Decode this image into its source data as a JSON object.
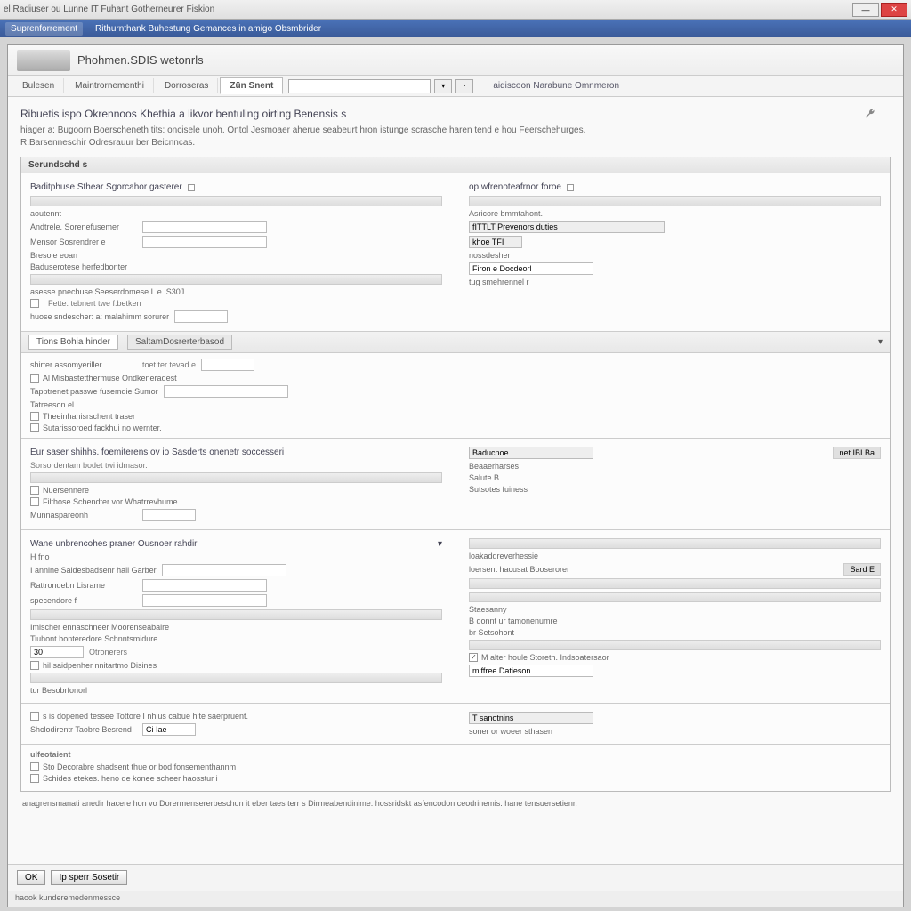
{
  "window": {
    "title": "el Radiuser ou Lunne IT Fuhant Gotherneurer Fiskion"
  },
  "titlebar_buttons": {
    "min": "—",
    "close": "✕"
  },
  "menubar": {
    "item0": "Suprenforrement",
    "item1": "Rithurnthank Buhestung Gemances in amigo Obsmbrider"
  },
  "header": {
    "title": "Phohmen.SDIS wetonrls"
  },
  "toolbar": {
    "tab0": "Bulesen",
    "tab1": "Maintrornementhi",
    "tab2": "Dorroseras",
    "tab3_active": "Zün Snent",
    "search_placeholder": "",
    "drop": "▾",
    "link": "aidiscoon Narabune Omnmeron"
  },
  "intro": {
    "heading": "Ribuetis ispo Okrennoos Khethia a likvor bentuling oirting Benensis s",
    "line1": "hiager a: Bugoorn Boerscheneth tits: oncisele unoh. Ontol Jesmoaer aherue seabeurt hron istunge scrasche haren tend e hou Feerschehurges.",
    "line2": "R.Barsenneschir Odresrauur ber Beicnncas."
  },
  "panel1": {
    "head": "Serundschd s",
    "left": {
      "subhead": "Baditphuse Sthear Sgorcahor gasterer",
      "f1": "aoutennt",
      "f2": "Andtrele. Sorenefusemer",
      "f3": "Mensor Sosrendrer e",
      "f4": "Bresoie eoan",
      "f5": "Baduserotese herfedbonter",
      "f6_label": "asesse pnechuse Seeserdomese L e IS30J",
      "f7": "Fette. tebnert twe f.betken",
      "f8": "huose sndescher: a: malahimm sorurer"
    },
    "right": {
      "subhead": "op wfrenoteafrnor foroe",
      "r1": "Asricore bmmtahont.",
      "r2_gray": "fITTLT Prevenors duties",
      "r3_gray": "khoe TFI",
      "r4": "nossdesher",
      "r5": "Firon e Docdeorl",
      "r6": "tug smehrennel r"
    }
  },
  "sect1": {
    "tab1": "Tions Bohia hinder",
    "tab2": "SaltamDosrerterbasod",
    "prompt": "shirter assomyeriller",
    "prompt2": "toet ter tevad e",
    "placeholder": ""
  },
  "block2": {
    "l1": "Al Misbastetthermuse Ondkeneradest",
    "l2": "Tapptrenet passwe fusemdie Sumor",
    "l3": "Tatreeson el",
    "l4": "Theeinhanisrschent traser",
    "l5": "Sutarissoroed fackhui no wernter."
  },
  "panel2": {
    "head_l": "Eur saser shihhs. foemiterens ov io Sasderts onenetr soccesseri",
    "head_r": "Baducnoe",
    "sub": "Sorsordentam bodet twi idmasor.",
    "right_badge": "net IBI Ba",
    "l1": "Nuersennere",
    "l2": "Filthose Schendter vor Whatrrevhume",
    "l3": "Munnaspareonh",
    "r1": "Beaaerharses",
    "r2": "Salute  B",
    "r3": "Sutsotes fuiness"
  },
  "panel3": {
    "head": "Wane unbrencohes praner Ousnoer rahdir",
    "l0": "H fno",
    "l1": "I annine Saldesbadsenr hall Garber",
    "l2": "Rattrondebn Lisrame",
    "l3": "specendore f",
    "l4": "Imischer ennaschneer Moorenseabaire",
    "l5": "Tiuhont bonteredore Schnntsmidure",
    "l6_num": "30",
    "l6_txt": "Otronerers",
    "l7": "hil saidpenher nnitartmo Disines",
    "l8": "tur Besobrfonorl",
    "r1": "loakaddreverhessie",
    "r2": "loersent hacusat Booserorer",
    "r2_badge": "Sard   E",
    "r3": "Staesanny",
    "r4": "B donnt ur tamonenumre",
    "r5": "br Setsohont",
    "r6": "M alter houle Storeth. Indsoatersaor",
    "r7": "miffree Datieson"
  },
  "panel4": {
    "l1": "s is dopened tessee Tottore I nhius cabue hite saerpruent.",
    "l2": "Shclodirentr Taobre Besrend",
    "l2_val": "Ci Iae",
    "r1": "T sanotnins",
    "r2": "soner or woeer sthasen"
  },
  "panel5": {
    "head": "ulfeotaient",
    "l1": "Sto Decorabre shadsent thue or bod fonsementhannm",
    "l2": "Schides etekes. heno de konee scheer haosstur i"
  },
  "footer_note": "anagrensmanati anedir hacere hon vo Dorermensererbeschun it eber taes terr s Dirmeabendinime. hossridskt asfencodon ceodrinemis. hane tensuersetienr.",
  "bottom": {
    "btn1": "OK",
    "btn2": "Ip sperr Sosetir"
  },
  "status": "haook    kunderemedenmessce"
}
